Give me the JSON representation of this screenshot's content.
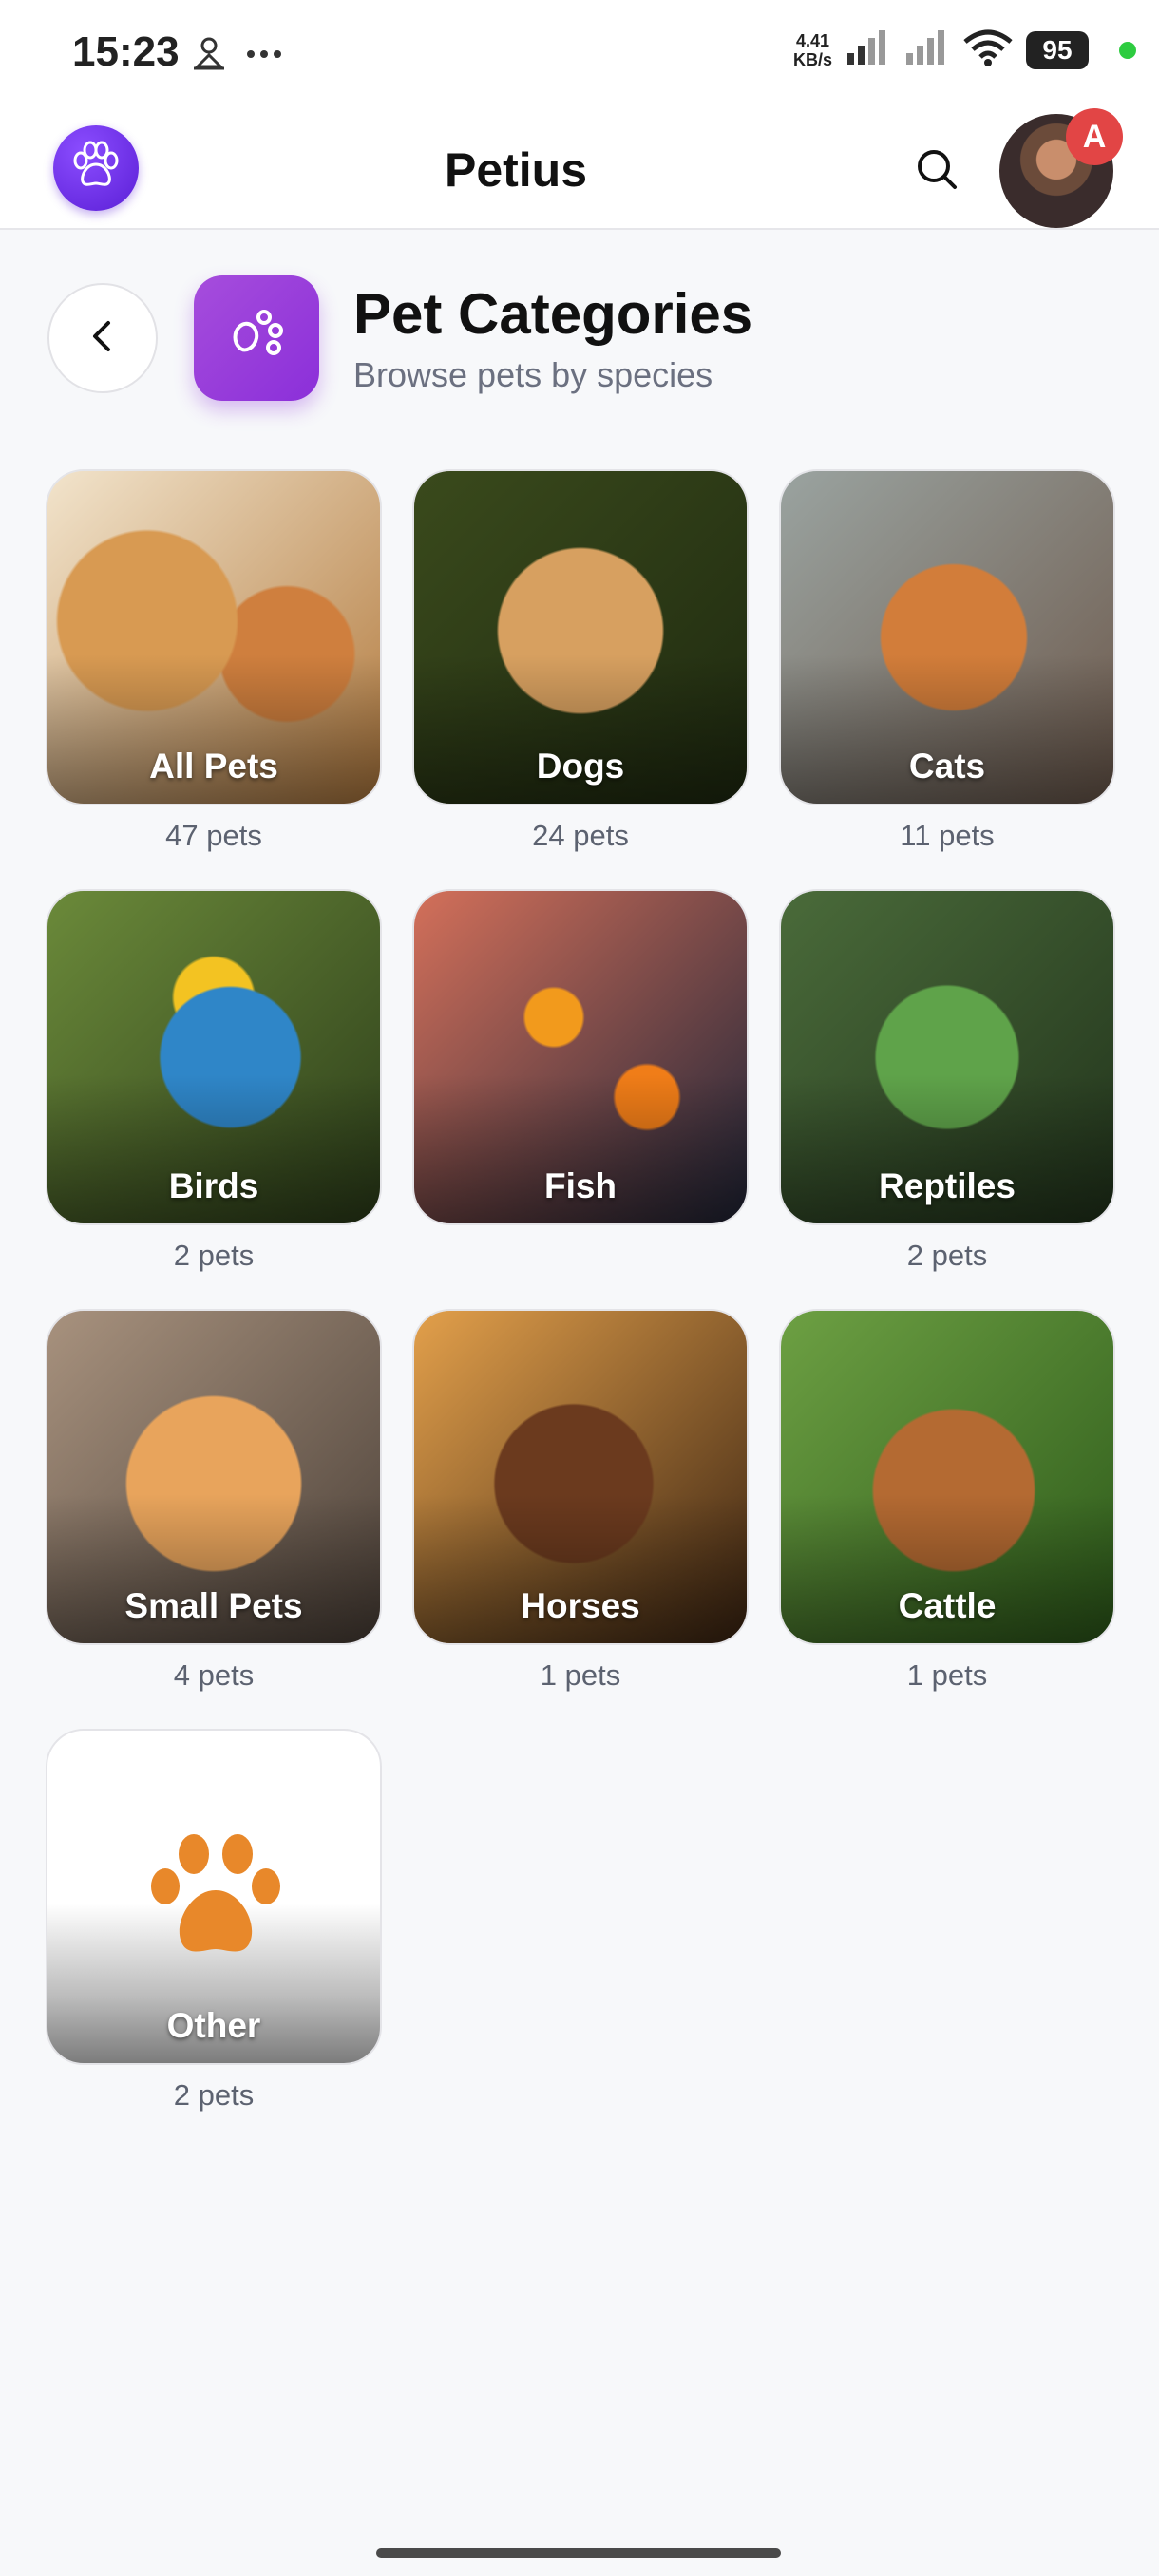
{
  "status_bar": {
    "time": "15:23",
    "net_speed_value": "4.41",
    "net_speed_unit": "KB/s",
    "battery": "95",
    "icons": [
      "location-person-icon",
      "more-dots-icon",
      "signal-icon",
      "signal-icon",
      "wifi-icon",
      "battery-icon"
    ]
  },
  "app_bar": {
    "title": "Petius",
    "logo_icon": "paw-icon",
    "search_icon": "search-icon",
    "avatar_badge": "A"
  },
  "header": {
    "back_icon": "chevron-left-icon",
    "category_icon": "paw-icon",
    "title": "Pet Categories",
    "subtitle": "Browse pets by species"
  },
  "categories": [
    {
      "name": "All Pets",
      "count": "47 pets"
    },
    {
      "name": "Dogs",
      "count": "24 pets"
    },
    {
      "name": "Cats",
      "count": "11 pets"
    },
    {
      "name": "Birds",
      "count": "2 pets"
    },
    {
      "name": "Fish",
      "count": ""
    },
    {
      "name": "Reptiles",
      "count": "2 pets"
    },
    {
      "name": "Small Pets",
      "count": "4 pets"
    },
    {
      "name": "Horses",
      "count": "1 pets"
    },
    {
      "name": "Cattle",
      "count": "1 pets"
    },
    {
      "name": "Other",
      "count": "2 pets"
    }
  ],
  "colors": {
    "accent_purple": "#8b2fd9",
    "logo_purple": "#5b1fd6",
    "badge_red": "#e24545",
    "other_paw_orange": "#e8882a"
  }
}
